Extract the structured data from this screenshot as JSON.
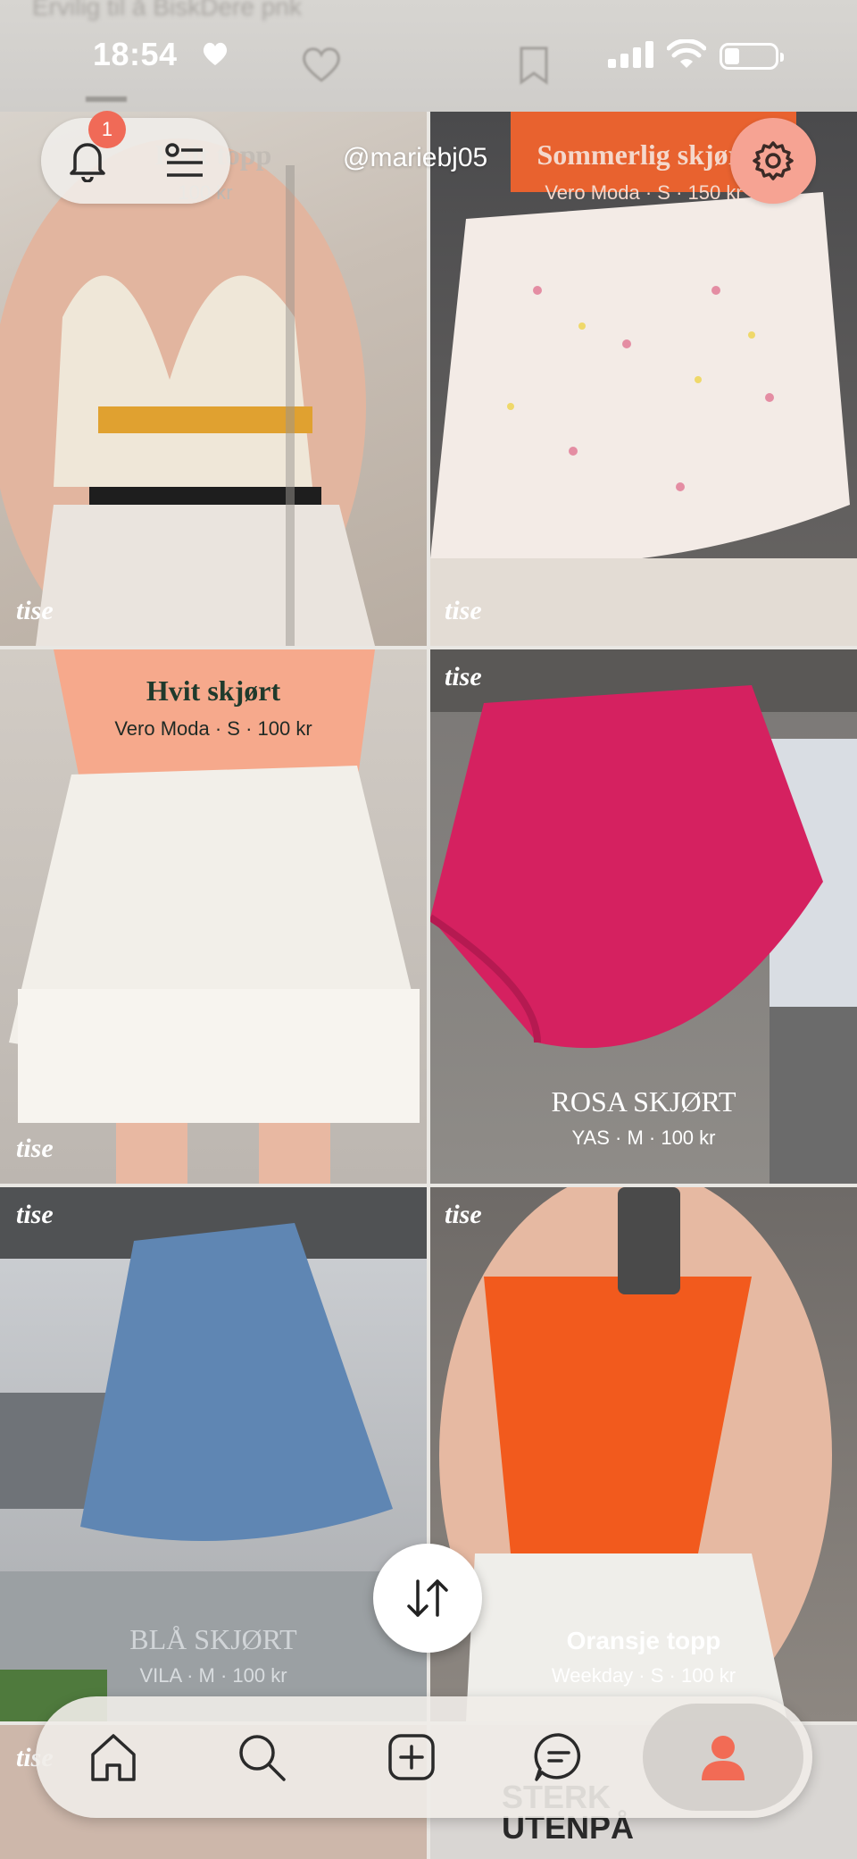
{
  "top_ghost_text": "Ervilig til å BiskDere pnk",
  "status_bar": {
    "time": "18:54"
  },
  "header": {
    "notification_count": "1",
    "username": "@mariebj05"
  },
  "listings": [
    {
      "title": "Hvit topp",
      "subtitle": "100 kr",
      "brand_mark": "tise"
    },
    {
      "title": "Sommerlig skjørt",
      "subtitle": "Vero Moda · S · 150 kr",
      "brand_mark": "tise"
    },
    {
      "title": "Hvit skjørt",
      "subtitle": "Vero Moda · S · 100 kr",
      "brand_mark": "tise"
    },
    {
      "title": "ROSA SKJØRT",
      "subtitle": "YAS · M · 100 kr",
      "brand_mark": "tise"
    },
    {
      "title": "BLÅ SKJØRT",
      "subtitle": "VILA · M · 100 kr",
      "brand_mark": "tise"
    },
    {
      "title": "Oransje topp",
      "subtitle": "Weekday · S · 100 kr",
      "brand_mark": "tise"
    }
  ],
  "bottom_peek": {
    "left_mark": "tise",
    "right_text": "STERK UTENPÅ"
  },
  "nav": [
    {
      "icon": "home-icon"
    },
    {
      "icon": "search-icon"
    },
    {
      "icon": "add-icon"
    },
    {
      "icon": "chat-icon"
    },
    {
      "icon": "profile-icon",
      "active": true
    }
  ],
  "colors": {
    "accent": "#f06a57",
    "active_icon": "#f26b55",
    "title_dark": "#1f3a2c"
  }
}
